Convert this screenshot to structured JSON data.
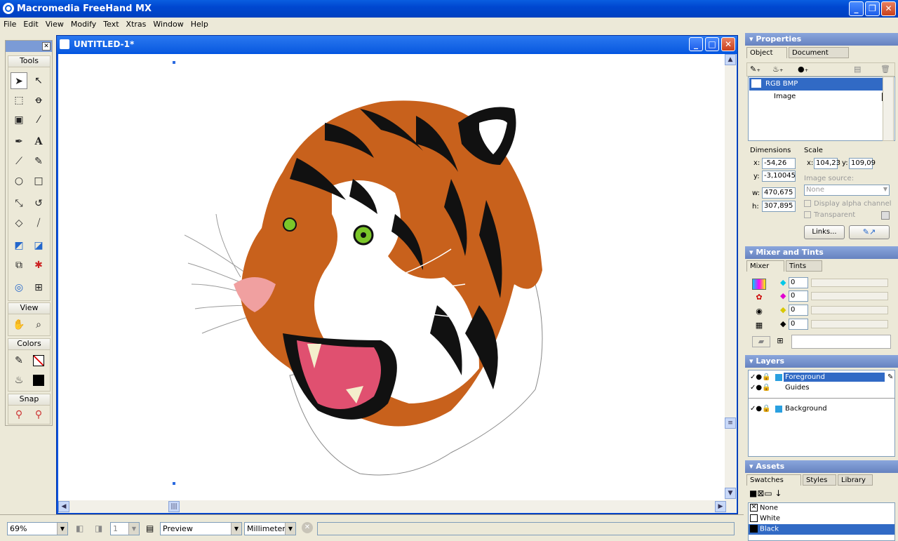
{
  "app": {
    "title": "Macromedia FreeHand MX",
    "logo": "freehand-logo-icon"
  },
  "menu": [
    "File",
    "Edit",
    "View",
    "Modify",
    "Text",
    "Xtras",
    "Window",
    "Help"
  ],
  "tools": {
    "header": "Tools",
    "view_label": "View",
    "colors_label": "Colors",
    "snap_label": "Snap"
  },
  "document": {
    "title": "UNTITLED-1*"
  },
  "status": {
    "zoom": "69%",
    "page": "1",
    "view_mode": "Preview",
    "units": "Millimeters"
  },
  "properties": {
    "title": "Properties",
    "tabs": [
      "Object",
      "Document"
    ],
    "items": [
      "RGB BMP",
      "Image"
    ],
    "dimensions_label": "Dimensions",
    "scale_label": "Scale",
    "x_label": "x:",
    "y_label": "y:",
    "w_label": "w:",
    "h_label": "h:",
    "x": "-54,26",
    "y": "-3,10045",
    "w": "470,675",
    "h": "307,895",
    "scale_x": "104,23",
    "scale_y": "109,09",
    "image_source_label": "Image source:",
    "image_source": "None",
    "display_alpha": "Display alpha channel",
    "transparent": "Transparent",
    "links_button": "Links..."
  },
  "mixer": {
    "title": "Mixer and Tints",
    "tabs": [
      "Mixer",
      "Tints"
    ],
    "channels": [
      {
        "value": "0",
        "color": "#00c8e8"
      },
      {
        "value": "0",
        "color": "#e000d0"
      },
      {
        "value": "0",
        "color": "#f0e000"
      },
      {
        "value": "0",
        "color": "#000000"
      }
    ]
  },
  "layers": {
    "title": "Layers",
    "items": [
      "Foreground",
      "Guides",
      "Background"
    ]
  },
  "assets": {
    "title": "Assets",
    "tabs": [
      "Swatches",
      "Styles",
      "Library"
    ],
    "swatches": [
      "None",
      "White",
      "Black"
    ]
  },
  "colors": {
    "titlebar": "#0054e3",
    "selection": "#316ac5",
    "layer_swatch": "#2aa0e0"
  }
}
